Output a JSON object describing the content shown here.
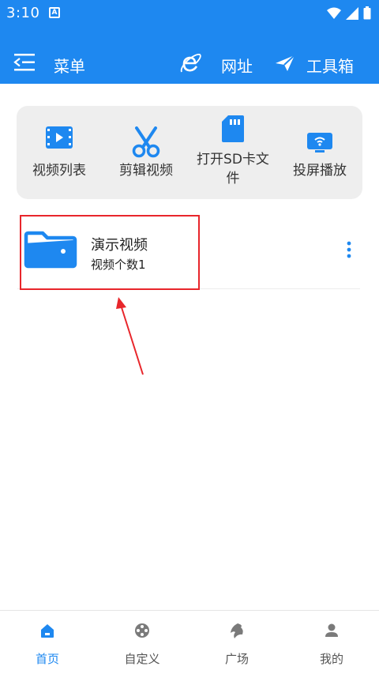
{
  "status_bar": {
    "time": "3:10",
    "badge": "A"
  },
  "app_bar": {
    "menu_label": "菜单",
    "web_label": "网址",
    "tools_label": "工具箱"
  },
  "quick_actions": [
    {
      "label": "视频列表",
      "icon": "video-list-icon"
    },
    {
      "label": "剪辑视频",
      "icon": "scissors-icon"
    },
    {
      "label": "打开SD卡文件",
      "icon": "sd-card-icon"
    },
    {
      "label": "投屏播放",
      "icon": "cast-screen-icon"
    }
  ],
  "folder": {
    "title": "演示视频",
    "count": "视频个数1"
  },
  "bottom_nav": [
    {
      "label": "首页",
      "icon": "home-icon",
      "active": true
    },
    {
      "label": "自定义",
      "icon": "film-reel-icon",
      "active": false
    },
    {
      "label": "广场",
      "icon": "plaza-icon",
      "active": false
    },
    {
      "label": "我的",
      "icon": "user-icon",
      "active": false
    }
  ],
  "colors": {
    "primary": "#1e88f0",
    "highlight_box": "#e8262b",
    "panel_bg": "#eeeeee"
  }
}
